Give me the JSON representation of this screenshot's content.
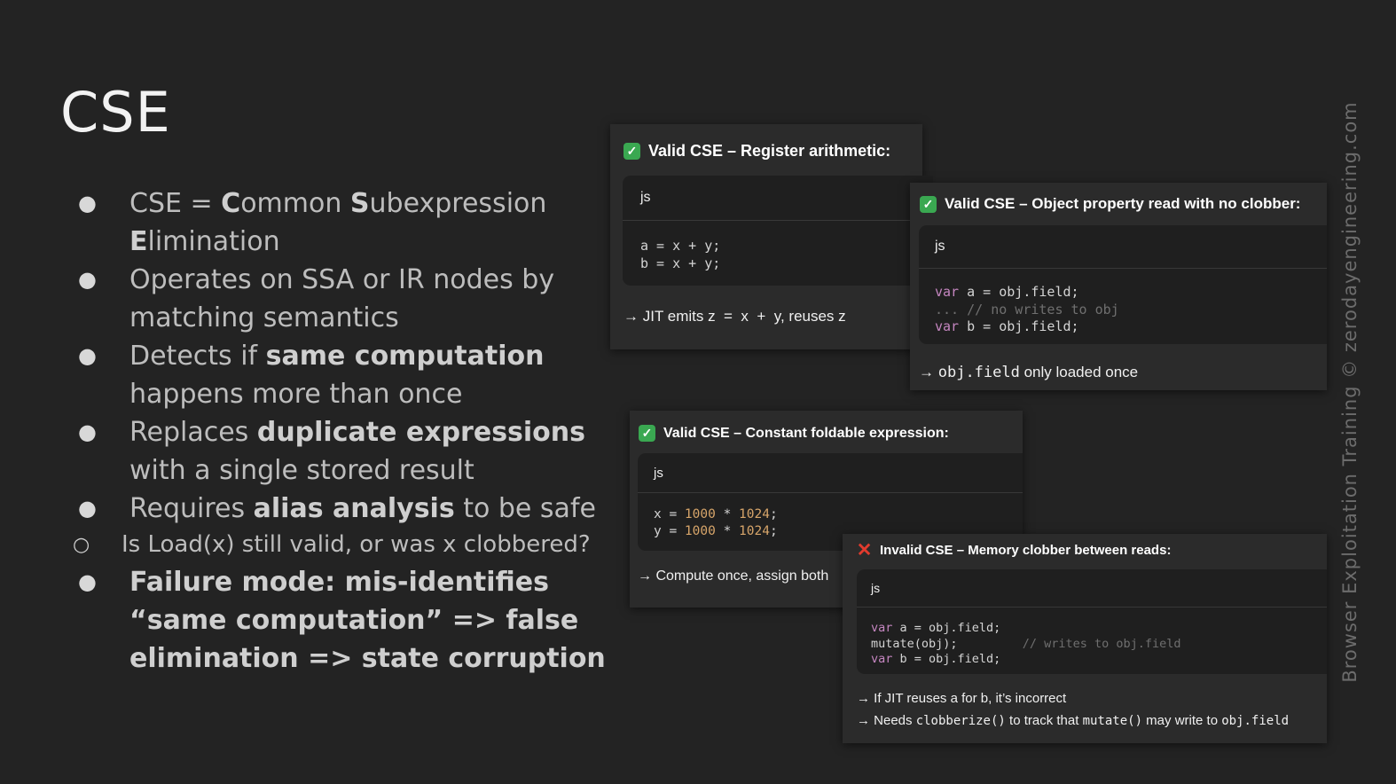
{
  "slide": {
    "title": "CSE",
    "bullets": {
      "b1": {
        "pre": "CSE = ",
        "c": "C",
        "ommon": "ommon ",
        "s": "S",
        "ubexpression": "ubexpression",
        "e": "E",
        "limination": "limination"
      },
      "b2": {
        "text": "Operates on SSA or IR nodes by matching semantics"
      },
      "b3": {
        "pre": "Detects if ",
        "bold": "same computation",
        "post": "happens more than once"
      },
      "b4": {
        "pre": "Replaces ",
        "bold": "duplicate expressions",
        "post": "with a single stored result"
      },
      "b5": {
        "pre": "Requires ",
        "bold": "alias analysis",
        "post": " to be safe"
      },
      "b5_sub": {
        "text": "Is Load(x) still valid, or was x clobbered?"
      },
      "b6": {
        "text": "Failure mode: mis-identifies “same computation” => false elimination => state corruption"
      }
    },
    "watermark": "Browser Exploitation Training © zerodayengineering.com"
  },
  "cards": {
    "register": {
      "title": "Valid CSE – Register arithmetic:",
      "lang": "js",
      "l1": "a = x + y;",
      "l2": "b = x + y;",
      "note_pre": "→ JIT emits z  =  x  +  y, reuses z"
    },
    "object": {
      "title": "Valid CSE – Object property read with no clobber:",
      "lang": "js",
      "l1_kw": "var",
      "l1": " a = obj.field;",
      "l2_dots": "... ",
      "l2_comment": "// no writes to obj",
      "l3_kw": "var",
      "l3": " b = obj.field;",
      "note_arrow": "→ ",
      "note_code": "obj.field",
      "note_post": " only loaded once"
    },
    "constant": {
      "title": "Valid CSE – Constant foldable expression:",
      "lang": "js",
      "l1_pre": "x = ",
      "l1_n1": "1000",
      "l1_op": " * ",
      "l1_n2": "1024",
      "l1_end": ";",
      "l2_pre": "y = ",
      "l2_n1": "1000",
      "l2_op": " * ",
      "l2_n2": "1024",
      "l2_end": ";",
      "note": "→ Compute once, assign both"
    },
    "invalid": {
      "title": "Invalid CSE – Memory clobber between reads:",
      "lang": "js",
      "l1_kw": "var",
      "l1": " a = obj.field;",
      "l2": "mutate(obj);         ",
      "l2_comment": "// writes to obj.field",
      "l3_kw": "var",
      "l3": " b = obj.field;",
      "note1": "→ If JIT reuses a for b, it’s incorrect",
      "note2_pre": "→ Needs ",
      "note2_code1": "clobberize()",
      "note2_mid": " to track that ",
      "note2_code2": "mutate()",
      "note2_mid2": " may write to ",
      "note2_code3": "obj.field"
    }
  }
}
